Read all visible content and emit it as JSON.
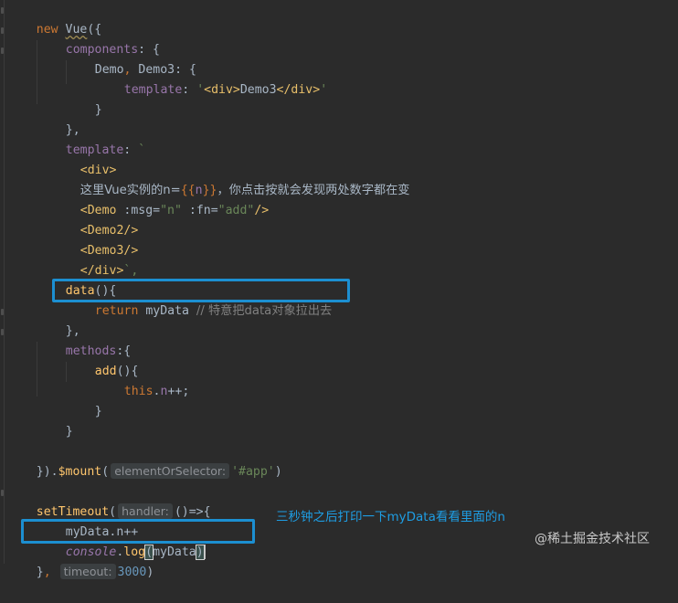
{
  "editor": {
    "theme_colors": {
      "background": "#2b2b2b",
      "keyword": "#cc7832",
      "function": "#ffc66d",
      "property": "#9876aa",
      "string": "#6a8759",
      "tag": "#e8bf6a",
      "comment": "#808080",
      "number": "#6897bb",
      "annotation_box": "#1c8fd1"
    },
    "lines": {
      "l01": {
        "a": "new ",
        "b": "Vue",
        "c": "({"
      },
      "l02": {
        "a": "components",
        "b": ": {"
      },
      "l03": {
        "a": "Demo",
        "b": ", ",
        "c": "Demo3",
        "d": ": {"
      },
      "l04": {
        "a": "template",
        "b": ": ",
        "c": "'",
        "d": "<div>",
        "e": "Demo3",
        "f": "</div>",
        "g": "'"
      },
      "l05": {
        "a": "}"
      },
      "l06": {
        "a": "},"
      },
      "l07": {
        "a": "template",
        "b": ": ",
        "c": "`"
      },
      "l08": {
        "a": "<div>"
      },
      "l09": {
        "a": "这里Vue实例的n=",
        "b": "{{",
        "c": "n",
        "d": "}}",
        "e": "，你点击按就会发现两处数字都在变"
      },
      "l10": {
        "a": "<Demo ",
        "b": ":msg=",
        "c": "\"n\"",
        "d": " :fn=",
        "e": "\"add\"",
        "f": "/>"
      },
      "l11": {
        "a": "<Demo2/>"
      },
      "l12": {
        "a": "<Demo3/>"
      },
      "l13": {
        "a": "</div>",
        "b": "`,"
      },
      "l14": {
        "a": "data",
        "b": "(){"
      },
      "l15": {
        "a": "return ",
        "b": "myData ",
        "c": "// 特意把data对象拉出去"
      },
      "l16": {
        "a": "},"
      },
      "l17": {
        "a": "methods",
        "b": ":{"
      },
      "l18": {
        "a": "add",
        "b": "(){"
      },
      "l19": {
        "a": "this",
        "b": ".",
        "c": "n",
        "d": "++;"
      },
      "l20": {
        "a": "}"
      },
      "l21": {
        "a": "}"
      },
      "l23": {
        "a": "})",
        "b": ".",
        "c": "$mount",
        "d": "(",
        "hint": "elementOrSelector:",
        "e": "'#app'",
        "f": ")"
      },
      "l25": {
        "a": "setTimeout",
        "b": "(",
        "hint": "handler:",
        "c": "()=>{"
      },
      "l26": {
        "a": "myData",
        "b": ".",
        "c": "n",
        "d": "++"
      },
      "l27": {
        "a": "console",
        "b": ".",
        "c": "log",
        "d": "(",
        "e": "myData",
        "f": ")"
      },
      "l28": {
        "a": "}",
        "b": ", ",
        "hint": "timeout:",
        "c": "3000",
        "d": ")"
      }
    }
  },
  "annotation": "三秒钟之后打印一下myData看看里面的n",
  "watermark": "@稀土掘金技术社区"
}
